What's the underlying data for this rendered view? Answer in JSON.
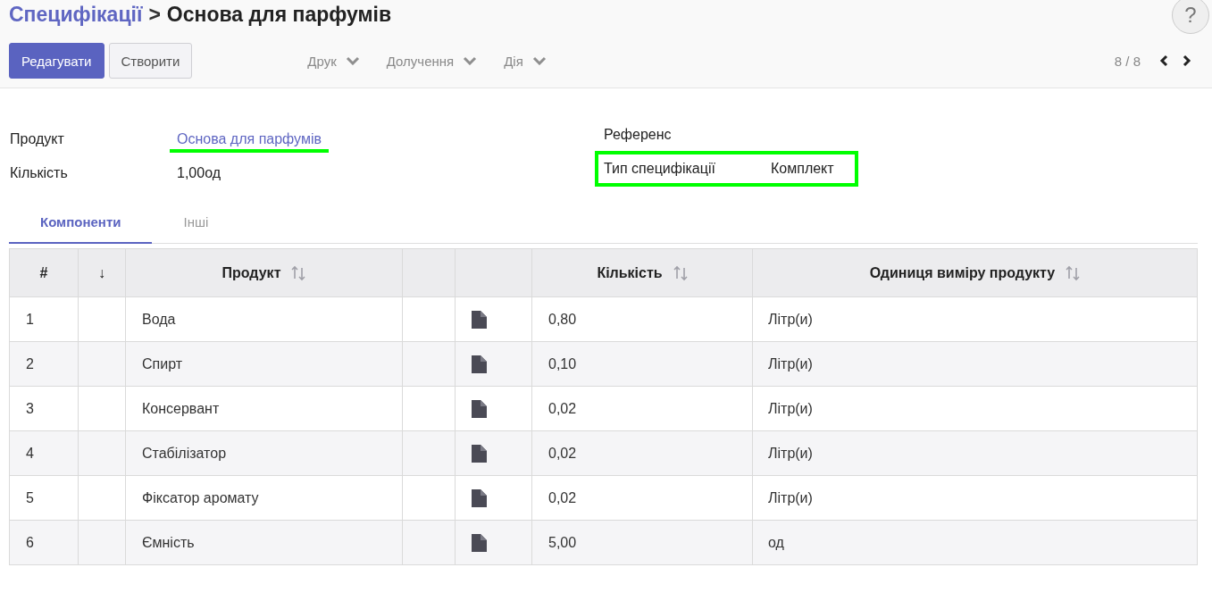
{
  "breadcrumb": {
    "parent": "Специфікації",
    "separator": ">",
    "current": "Основа для парфумів"
  },
  "help_button": "?",
  "buttons": [
    {
      "label": "Редагувати",
      "kind": "primary"
    },
    {
      "label": "Створити",
      "kind": "secondary"
    }
  ],
  "menus": [
    "Друк",
    "Долучення",
    "Дія"
  ],
  "pager": {
    "text": "8 / 8"
  },
  "form": {
    "left": [
      {
        "label": "Продукт",
        "value": "Основа для парфумів",
        "kind": "link"
      },
      {
        "label": "Кількість",
        "value": "1,00од",
        "kind": "text"
      }
    ],
    "right": [
      {
        "label": "Референс"
      },
      {
        "label": "Тип специфікації",
        "value": "Комплект"
      }
    ]
  },
  "tabs": [
    {
      "label": "Компоненти",
      "selected": true
    },
    {
      "label": "Інші",
      "selected": false
    }
  ],
  "table": {
    "columns": [
      "#",
      "↓",
      "Продукт",
      "",
      "",
      "Кількість",
      "Одиниця виміру продукту"
    ],
    "rows": [
      {
        "num": "1",
        "product": "Вода",
        "qty": "0,80",
        "uom": "Літр(и)"
      },
      {
        "num": "2",
        "product": "Спирт",
        "qty": "0,10",
        "uom": "Літр(и)"
      },
      {
        "num": "3",
        "product": "Консервант",
        "qty": "0,02",
        "uom": "Літр(и)"
      },
      {
        "num": "4",
        "product": "Стабілізатор",
        "qty": "0,02",
        "uom": "Літр(и)"
      },
      {
        "num": "5",
        "product": "Фіксатор аромату",
        "qty": "0,02",
        "uom": "Літр(и)"
      },
      {
        "num": "6",
        "product": "Ємність",
        "qty": "5,00",
        "uom": "од"
      }
    ]
  }
}
